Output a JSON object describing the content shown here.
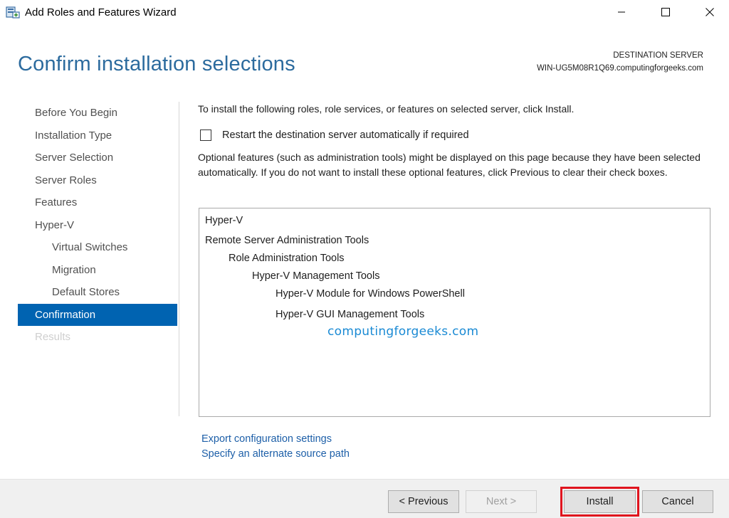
{
  "window": {
    "title": "Add Roles and Features Wizard",
    "controls": {
      "minimize": "minimize-icon",
      "maximize": "maximize-icon",
      "close": "close-icon"
    }
  },
  "header": {
    "page_title": "Confirm installation selections",
    "destination_label": "DESTINATION SERVER",
    "destination_value": "WIN-UG5M08R1Q69.computingforgeeks.com"
  },
  "nav": {
    "items": [
      {
        "label": "Before You Begin",
        "state": "normal"
      },
      {
        "label": "Installation Type",
        "state": "normal"
      },
      {
        "label": "Server Selection",
        "state": "normal"
      },
      {
        "label": "Server Roles",
        "state": "normal"
      },
      {
        "label": "Features",
        "state": "normal"
      },
      {
        "label": "Hyper-V",
        "state": "normal"
      },
      {
        "label": "Virtual Switches",
        "state": "sub"
      },
      {
        "label": "Migration",
        "state": "sub"
      },
      {
        "label": "Default Stores",
        "state": "sub"
      },
      {
        "label": "Confirmation",
        "state": "active"
      },
      {
        "label": "Results",
        "state": "disabled"
      }
    ]
  },
  "content": {
    "intro": "To install the following roles, role services, or features on selected server, click Install.",
    "restart_label": "Restart the destination server automatically if required",
    "restart_checked": false,
    "optional_note": "Optional features (such as administration tools) might be displayed on this page because they have been selected automatically. If you do not want to install these optional features, click Previous to clear their check boxes.",
    "selections": [
      {
        "label": "Hyper-V",
        "level": 0
      },
      {
        "label": "Remote Server Administration Tools",
        "level": 0
      },
      {
        "label": "Role Administration Tools",
        "level": 1
      },
      {
        "label": "Hyper-V Management Tools",
        "level": 2
      },
      {
        "label": "Hyper-V Module for Windows PowerShell",
        "level": 3
      },
      {
        "label": "Hyper-V GUI Management Tools",
        "level": 3
      }
    ],
    "watermark": "computingforgeeks.com",
    "links": {
      "export": "Export configuration settings",
      "alternate_source": "Specify an alternate source path"
    }
  },
  "footer": {
    "previous": "< Previous",
    "next": "Next >",
    "install": "Install",
    "cancel": "Cancel",
    "highlight_color": "#e0141e"
  },
  "colors": {
    "accent": "#0063b1",
    "title": "#2c6b9e",
    "link": "#1d5fa8",
    "watermark": "#1a8ad4"
  }
}
